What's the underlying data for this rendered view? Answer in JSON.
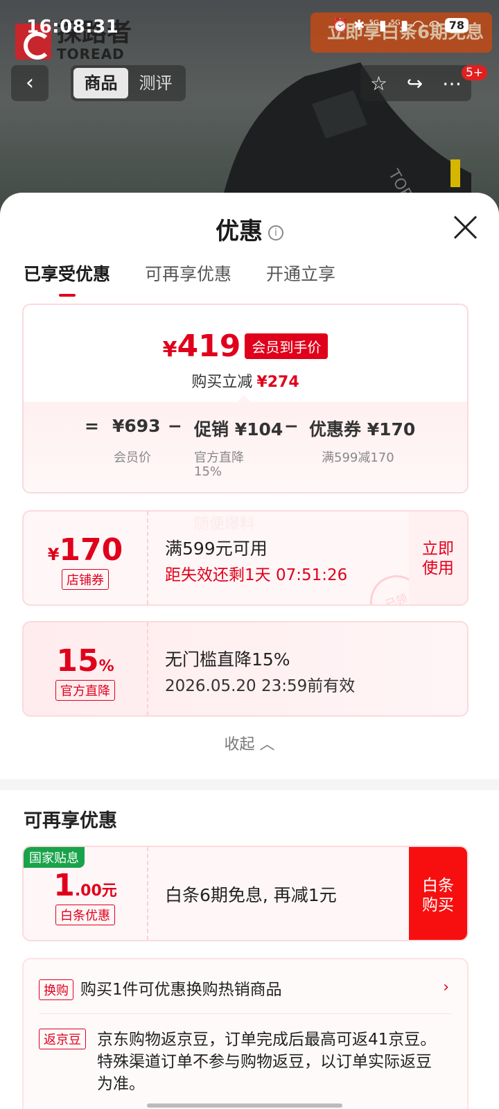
{
  "status": {
    "time": "16:08:31",
    "signal1": "5G",
    "signal2": "5G",
    "battery": "78"
  },
  "background": {
    "brand_cn": "探路者",
    "brand_en": "TOREAD",
    "promo_text": "立即享白条6期免息"
  },
  "nav": {
    "tabs": [
      "商品",
      "测评"
    ],
    "active_tab": 0,
    "more_badge": "5+"
  },
  "sheet": {
    "title": "优惠",
    "tabs": [
      "已享受优惠",
      "可再享优惠",
      "开通立享"
    ],
    "active_tab": 0,
    "summary": {
      "currency": "¥",
      "final_price": "419",
      "final_tag": "会员到手价",
      "reduce_label": "购买立减",
      "reduce_value": "¥274",
      "formula": {
        "equals": "=",
        "member_price": "¥693",
        "member_label": "会员价",
        "minus1": "−",
        "promo": "促销 ¥104",
        "promo_label1": "官方直降",
        "promo_label2": "15%",
        "minus2": "−",
        "coupon": "优惠券 ¥170",
        "coupon_label": "满599减170"
      }
    },
    "coupon1": {
      "currency": "¥",
      "value": "170",
      "tag": "店铺券",
      "title": "满599元可用",
      "expiry": "距失效还剩1天 07:51:26",
      "button": [
        "立即",
        "使用"
      ],
      "stamp": "已领",
      "watermark": "随便爆料"
    },
    "coupon2": {
      "value": "15",
      "unit": "%",
      "tag": "官方直降",
      "title": "无门槛直降15%",
      "validity": "2026.05.20 23:59前有效"
    },
    "collapse": "收起",
    "more_section": {
      "title": "可再享优惠",
      "baitiao": {
        "badge": "国家贴息",
        "value_int": "1",
        "value_dec": ".00元",
        "tag": "白条优惠",
        "title": "白条6期免息, 再减1元",
        "button": [
          "白条",
          "购买"
        ]
      },
      "list": [
        {
          "tag": "换购",
          "text": "购买1件可优惠换购热销商品"
        },
        {
          "tag": "返京豆",
          "lines": [
            "京东购物返京豆，订单完成后最高可返41京豆。",
            "特殊渠道订单不参与购物返豆，以订单实际返豆",
            "为准。"
          ]
        }
      ]
    }
  },
  "colors": {
    "accent": "#e0001b",
    "green_badge": "#18a34a"
  }
}
